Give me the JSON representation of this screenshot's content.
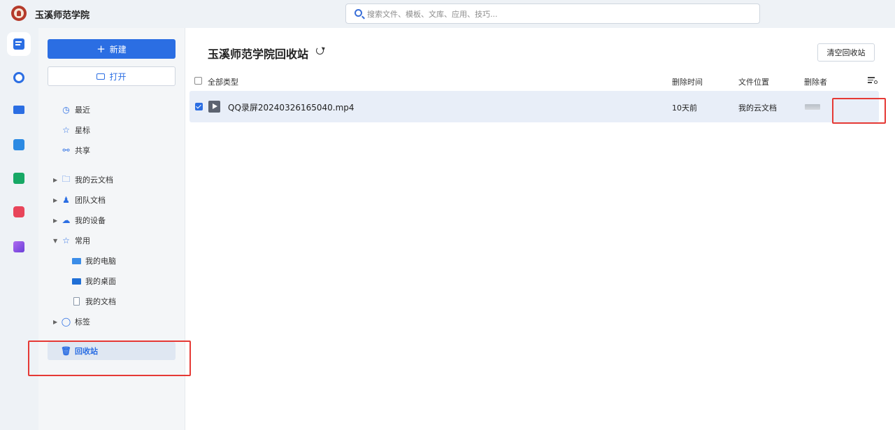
{
  "app": {
    "title": "玉溪师范学院"
  },
  "search": {
    "placeholder": "搜索文件、模板、文库、应用、技巧..."
  },
  "rail": {
    "items": [
      {
        "icon": "document-icon",
        "color": "#2b6ee3",
        "active": true
      },
      {
        "icon": "clock-icon",
        "color": "#2b6ee3"
      },
      {
        "icon": "video-meeting-icon",
        "color": "#2b6ee3"
      },
      {
        "icon": "calendar-icon",
        "color": "#2b6ee3"
      },
      {
        "icon": "form-icon",
        "color": "#17a865"
      },
      {
        "icon": "pdf-icon",
        "color": "#e8455a"
      },
      {
        "icon": "apps-icon",
        "color": "#7a4be0"
      }
    ]
  },
  "sidebar": {
    "new_label": "新建",
    "open_label": "打开",
    "quick": [
      {
        "label": "最近",
        "icon": "clock-icon"
      },
      {
        "label": "星标",
        "icon": "star-icon"
      },
      {
        "label": "共享",
        "icon": "share-icon"
      }
    ],
    "tree": [
      {
        "label": "我的云文档",
        "icon": "folder-icon"
      },
      {
        "label": "团队文档",
        "icon": "team-icon"
      },
      {
        "label": "我的设备",
        "icon": "cloud-device-icon"
      },
      {
        "label": "常用",
        "icon": "pin-icon",
        "expanded": true
      },
      {
        "label": "我的电脑",
        "icon": "computer-icon"
      },
      {
        "label": "我的桌面",
        "icon": "desktop-icon"
      },
      {
        "label": "我的文档",
        "icon": "document-icon"
      },
      {
        "label": "标签",
        "icon": "tag-icon"
      }
    ],
    "trash_label": "回收站"
  },
  "main": {
    "title": "玉溪师范学院回收站",
    "empty_button": "清空回收站",
    "columns": {
      "type": "全部类型",
      "deleted_time": "删除时间",
      "location": "文件位置",
      "deleter": "删除者"
    },
    "rows": [
      {
        "name": "QQ录屏20240326165040.mp4",
        "deleted_time": "10天前",
        "location": "我的云文档",
        "selected": true
      }
    ]
  },
  "colors": {
    "accent": "#2b6ee3",
    "highlight": "#e53935"
  }
}
